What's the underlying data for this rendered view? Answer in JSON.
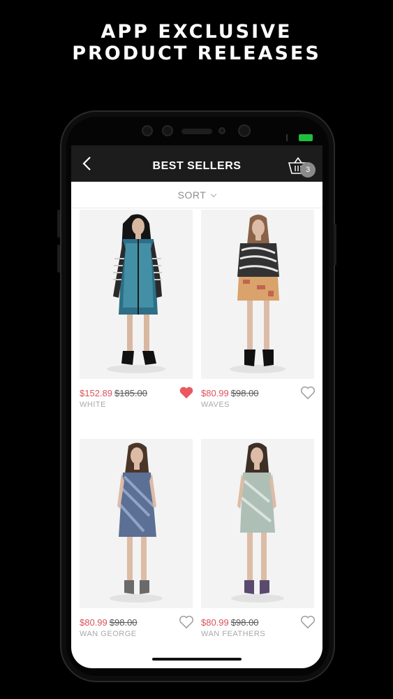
{
  "promo": {
    "line1": "APP EXCLUSIVE",
    "line2": "PRODUCT RELEASES"
  },
  "nav": {
    "title": "BEST SELLERS",
    "cart_count": "3"
  },
  "sort": {
    "label": "SORT"
  },
  "products": [
    {
      "price": "$152.89",
      "original_price": "$185.00",
      "name": "WHITE",
      "favorited": true
    },
    {
      "price": "$80.99",
      "original_price": "$98.00",
      "name": "WAVES",
      "favorited": false
    },
    {
      "price": "$80.99",
      "original_price": "$98.00",
      "name": "WAN GEORGE",
      "favorited": false
    },
    {
      "price": "$80.99",
      "original_price": "$98.00",
      "name": "WAN FEATHERS",
      "favorited": false
    }
  ],
  "colors": {
    "sale_price": "#d9535a",
    "favorite_heart": "#e85a5f",
    "nav_background": "#1c1c1c"
  }
}
